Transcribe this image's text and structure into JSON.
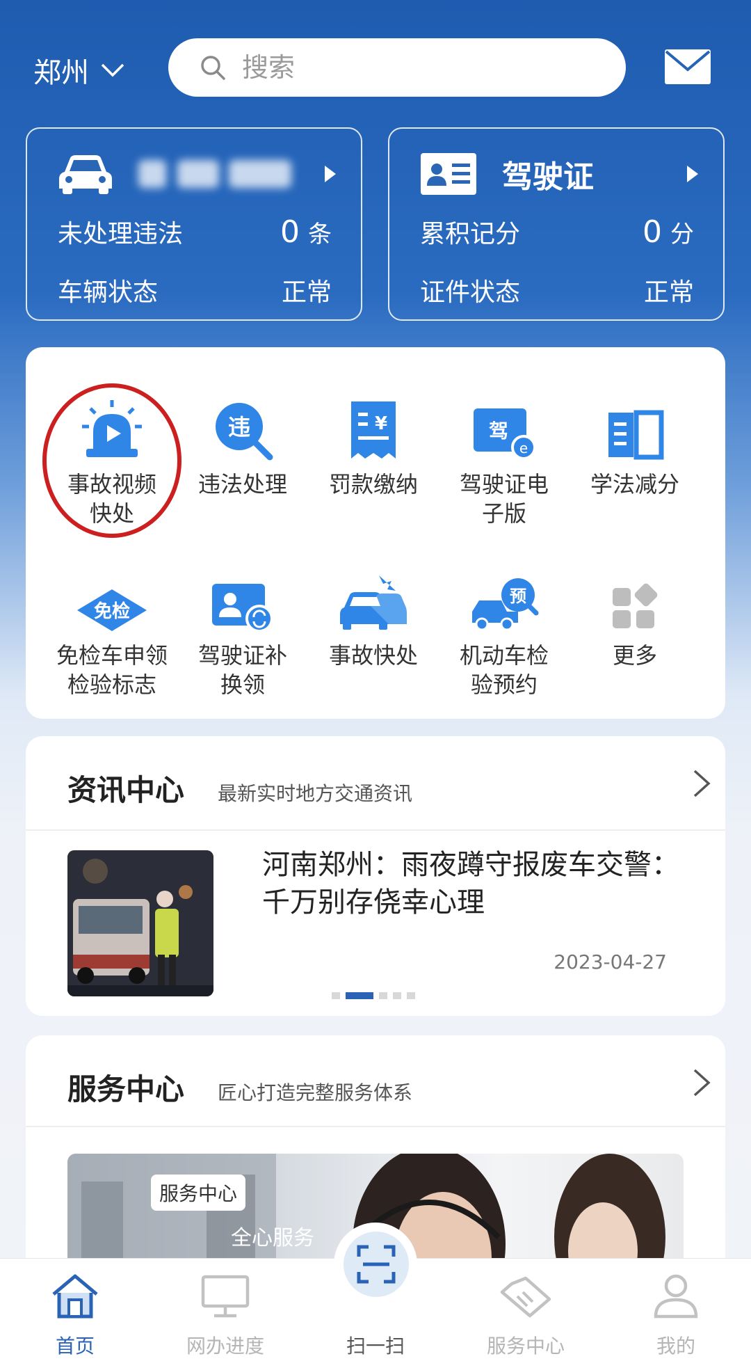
{
  "header": {
    "city": "郑州",
    "search_placeholder": "搜索"
  },
  "vehicle_card": {
    "row1_label": "未处理违法",
    "row1_value": "0",
    "row1_unit": "条",
    "row2_label": "车辆状态",
    "row2_value": "正常"
  },
  "license_card": {
    "title": "驾驶证",
    "row1_label": "累积记分",
    "row1_value": "0",
    "row1_unit": "分",
    "row2_label": "证件状态",
    "row2_value": "正常"
  },
  "services": [
    {
      "label": "事故视频\n快处",
      "icon": "siren-video-icon"
    },
    {
      "label": "违法处理",
      "icon": "violation-search-icon"
    },
    {
      "label": "罚款缴纳",
      "icon": "fine-receipt-icon"
    },
    {
      "label": "驾驶证电\n子版",
      "icon": "e-license-icon"
    },
    {
      "label": "学法减分",
      "icon": "book-icon"
    },
    {
      "label": "免检车申领\n检验标志",
      "icon": "exempt-badge-icon"
    },
    {
      "label": "驾驶证补\n换领",
      "icon": "license-renew-icon"
    },
    {
      "label": "事故快处",
      "icon": "car-crash-icon"
    },
    {
      "label": "机动车检\n验预约",
      "icon": "inspection-booking-icon"
    },
    {
      "label": "更多",
      "icon": "more-grid-icon"
    }
  ],
  "news": {
    "title": "资讯中心",
    "subtitle": "最新实时地方交通资讯",
    "item_title": "河南郑州：雨夜蹲守报废车交警：千万别存侥幸心理",
    "item_date": "2023-04-27",
    "carousel_active_index": 1,
    "carousel_count": 5
  },
  "service_center": {
    "title": "服务中心",
    "subtitle": "匠心打造完整服务体系",
    "banner_tag": "服务中心",
    "banner_slogan": "全心服务"
  },
  "tabbar": [
    {
      "label": "首页",
      "icon": "home-icon",
      "active": true
    },
    {
      "label": "网办进度",
      "icon": "monitor-icon",
      "active": false
    },
    {
      "label": "扫一扫",
      "icon": "scan-icon",
      "active": false
    },
    {
      "label": "服务中心",
      "icon": "handshake-icon",
      "active": false
    },
    {
      "label": "我的",
      "icon": "user-icon",
      "active": false
    }
  ],
  "colors": {
    "primary": "#2a63b5",
    "icon_blue": "#2f86e6",
    "highlight_ring": "#cc1f1f"
  }
}
